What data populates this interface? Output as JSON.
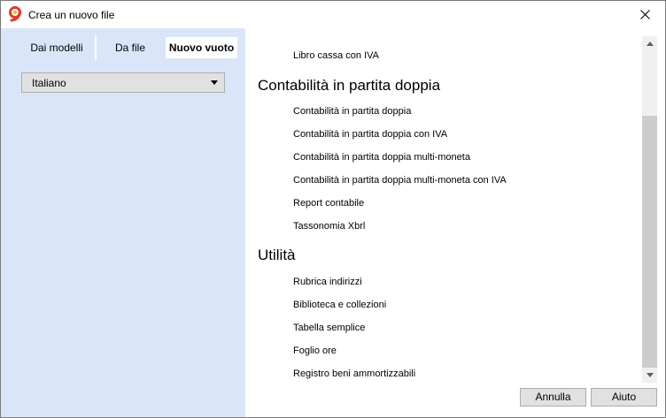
{
  "window": {
    "title": "Crea un nuovo file"
  },
  "tabs": [
    {
      "label": "Dai modelli"
    },
    {
      "label": "Da file"
    },
    {
      "label": "Nuovo vuoto"
    }
  ],
  "language_select": {
    "value": "Italiano"
  },
  "list": {
    "top_item": "Libro cassa con IVA",
    "groups": [
      {
        "heading": "Contabilità in partita doppia",
        "items": [
          "Contabilità in partita doppia",
          "Contabilità in partita doppia con IVA",
          "Contabilità in partita doppia multi-moneta",
          "Contabilità in partita doppia multi-moneta con IVA",
          "Report contabile",
          "Tassonomia Xbrl"
        ]
      },
      {
        "heading": "Utilità",
        "items": [
          "Rubrica indirizzi",
          "Biblioteca e collezioni",
          "Tabella semplice",
          "Foglio ore",
          "Registro beni ammortizzabili"
        ]
      }
    ]
  },
  "buttons": {
    "cancel": "Annulla",
    "help": "Aiuto"
  },
  "icons": {
    "logo": "banana-logo-icon",
    "close": "close-icon",
    "dropdown": "caret-down-icon",
    "scroll_up": "arrow-up-icon",
    "scroll_down": "arrow-down-icon"
  },
  "colors": {
    "left_panel": "#dae6f8",
    "logo_red": "#e03a2f",
    "logo_yellow": "#f6c21c"
  }
}
